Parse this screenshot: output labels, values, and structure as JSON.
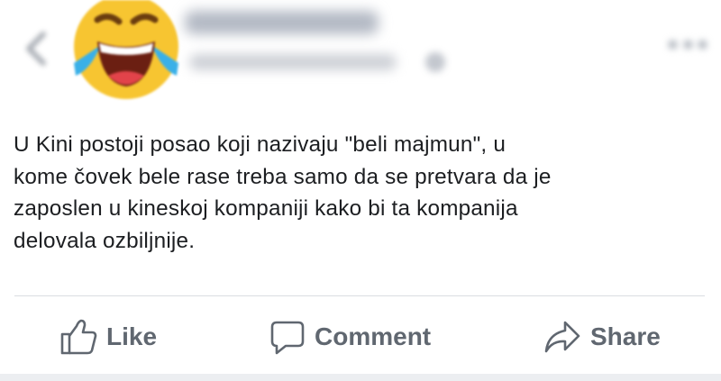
{
  "post": {
    "text": "U Kini postoji posao koji nazivaju \"beli majmun\", u\nkome čovek bele rase treba samo da se pretvara da je\nzaposlen u kineskoj kompaniji kako bi ta kompanija\ndelovala ozbiljnije."
  },
  "header": {
    "back_icon": "chevron-left-icon",
    "avatar_icon": "laughing-emoji-icon",
    "more_icon": "more-horizontal-icon",
    "privacy_icon": "globe-icon"
  },
  "actions": {
    "like_label": "Like",
    "comment_label": "Comment",
    "share_label": "Share"
  },
  "colors": {
    "text": "#1c1e21",
    "action_text": "#606770",
    "divider": "#dadde1",
    "emoji_face": "#f7c531",
    "emoji_tears": "#3ab0e8"
  }
}
